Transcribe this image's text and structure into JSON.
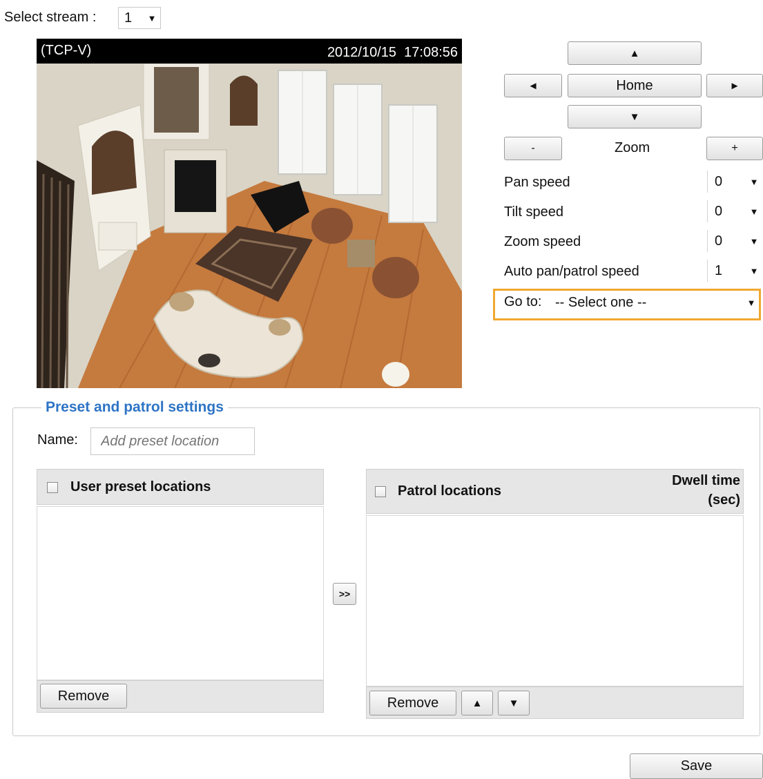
{
  "stream": {
    "label": "Select stream :",
    "value": "1"
  },
  "video": {
    "protocol": "(TCP-V)",
    "timestamp": "2012/10/15  17:08:56",
    "image_description": "Overhead view of living room"
  },
  "ptz": {
    "up": "▲",
    "down": "▼",
    "left": "◄",
    "right": "►",
    "home": "Home",
    "zoom_out": "-",
    "zoom_label": "Zoom",
    "zoom_in": "+",
    "speeds": [
      {
        "label": "Pan speed",
        "value": "0"
      },
      {
        "label": "Tilt speed",
        "value": "0"
      },
      {
        "label": "Zoom speed",
        "value": "0"
      },
      {
        "label": "Auto pan/patrol speed",
        "value": "1"
      }
    ],
    "goto_label": "Go to:",
    "goto_value": "-- Select one --"
  },
  "preset": {
    "legend": "Preset and patrol settings",
    "name_label": "Name:",
    "name_placeholder": "Add preset location",
    "user_presets_header": "User preset locations",
    "patrol_header": "Patrol locations",
    "dwell_line1": "Dwell time",
    "dwell_line2": "(sec)",
    "move_button": ">>",
    "remove_left": "Remove",
    "remove_right": "Remove",
    "up": "▲",
    "down": "▼"
  },
  "save_label": "Save",
  "colors": {
    "accent": "#2e74c5",
    "highlight": "#f0a830"
  }
}
